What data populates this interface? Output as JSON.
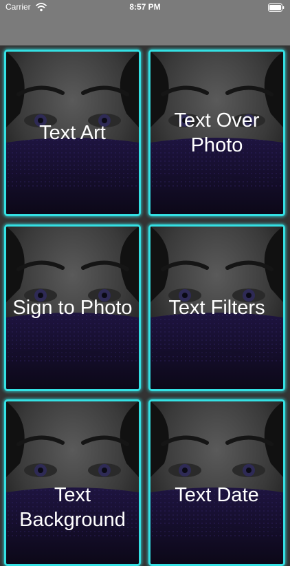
{
  "status_bar": {
    "carrier": "Carrier",
    "time": "8:57 PM",
    "wifi_icon": "wifi-icon",
    "battery_icon": "battery-icon"
  },
  "tiles": [
    {
      "label": "Text Art"
    },
    {
      "label": "Text Over\nPhoto"
    },
    {
      "label": "Sign to Photo"
    },
    {
      "label": "Text Filters"
    },
    {
      "label": "Text\nBackground"
    },
    {
      "label": "Text Date"
    }
  ],
  "colors": {
    "accent": "#34e0e3",
    "background": "#333333",
    "nav_bar": "#7b7b7b"
  }
}
